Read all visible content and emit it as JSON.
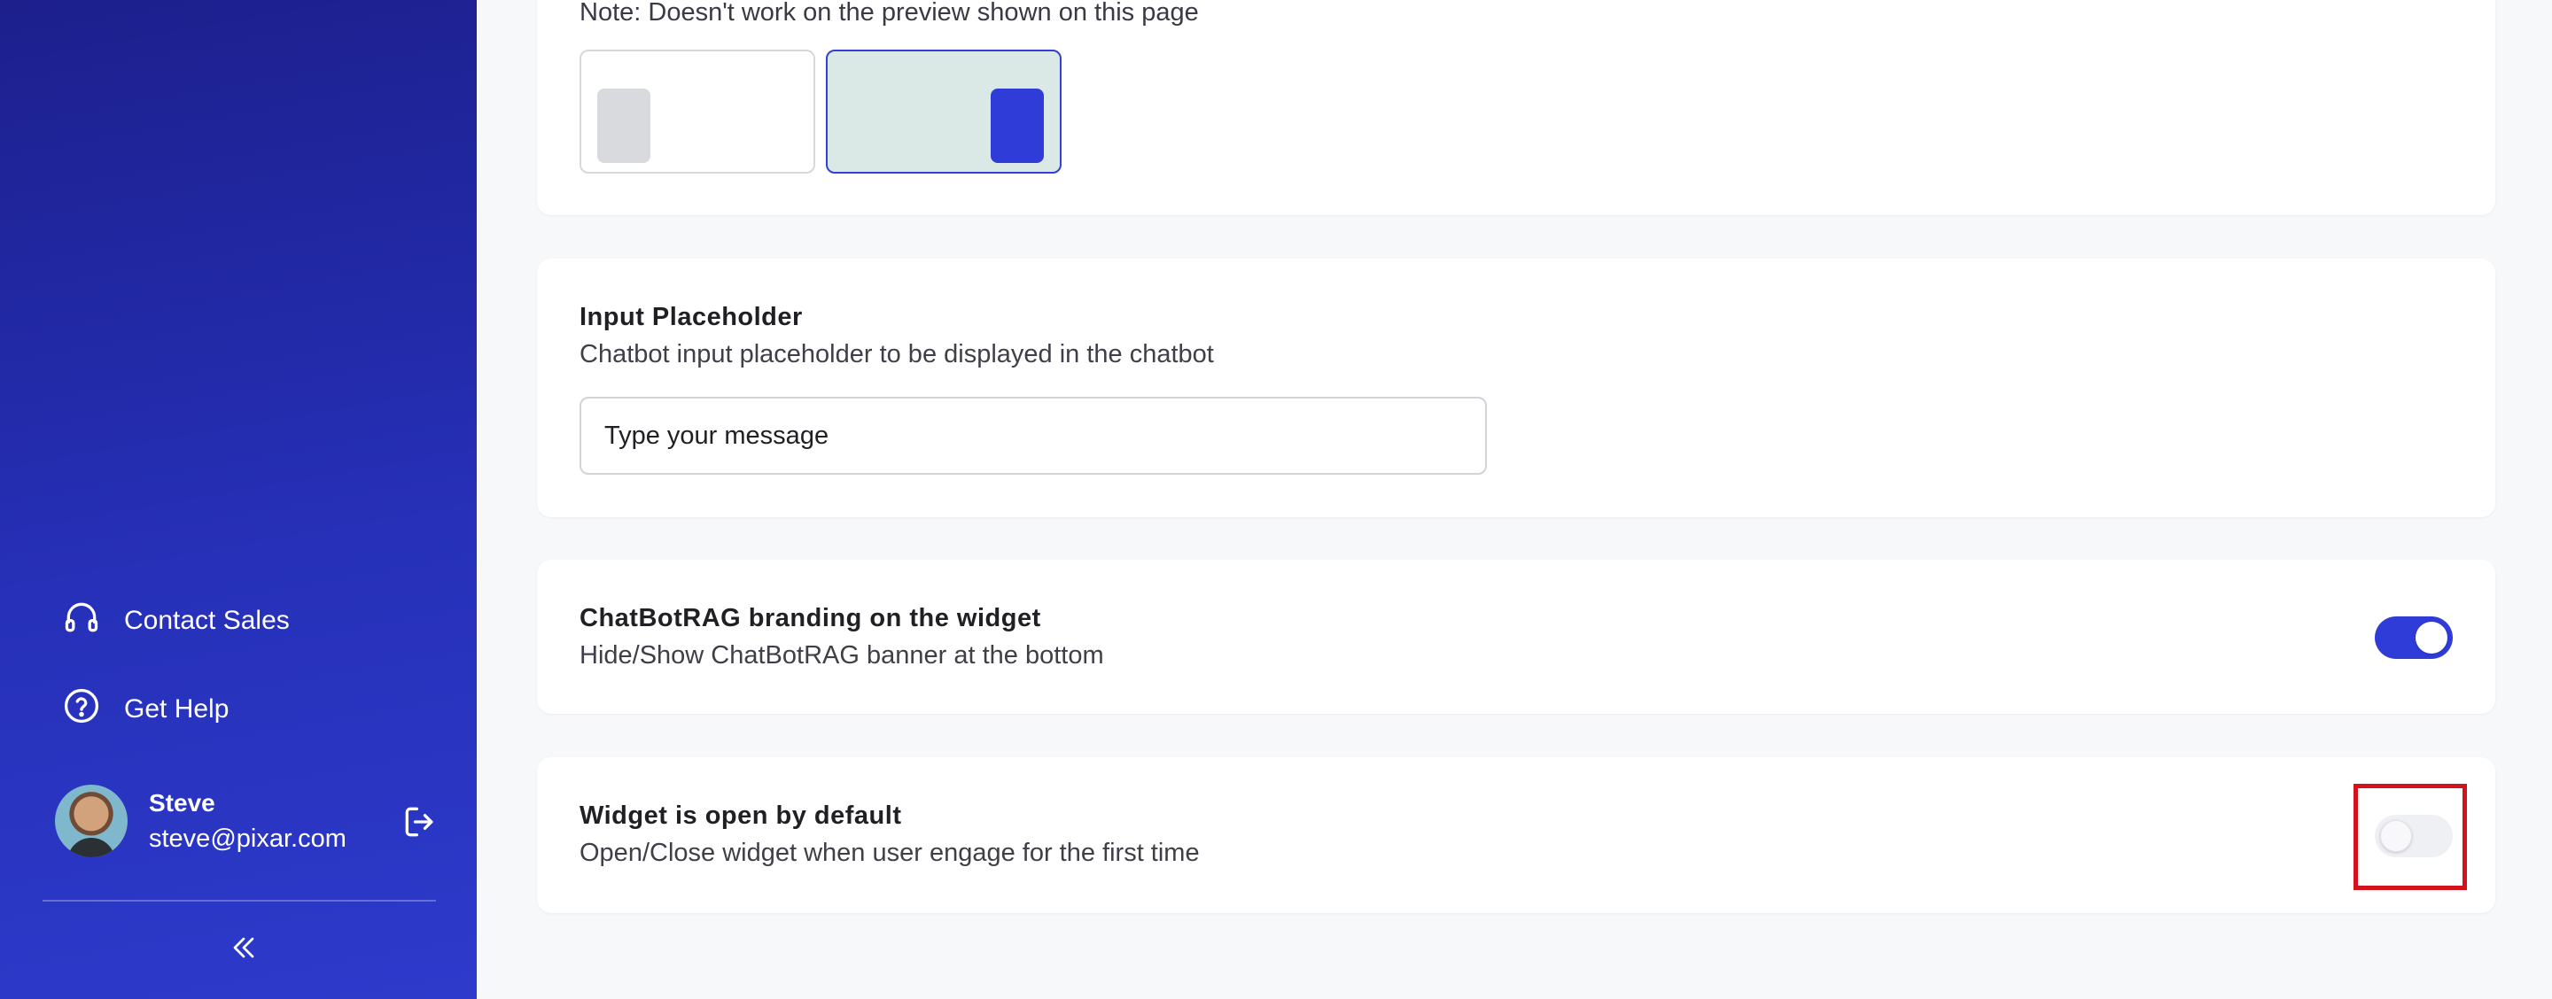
{
  "sidebar": {
    "nav": [
      {
        "label": "Contact Sales",
        "icon": "headset-icon"
      },
      {
        "label": "Get Help",
        "icon": "help-circle-icon"
      }
    ],
    "user": {
      "name": "Steve",
      "email": "steve@pixar.com"
    },
    "logout_icon": "logout-icon",
    "collapse_icon": "chevrons-left-icon"
  },
  "widget_position": {
    "note": "Note: Doesn't work on the preview shown on this page",
    "options": [
      "left",
      "right"
    ],
    "selected": "right"
  },
  "input_placeholder": {
    "title": "Input Placeholder",
    "description": "Chatbot input placeholder to be displayed in the chatbot",
    "value": "Type your message"
  },
  "branding": {
    "title": "ChatBotRAG branding on the widget",
    "description": "Hide/Show ChatBotRAG banner at the bottom",
    "enabled": true
  },
  "open_by_default": {
    "title": "Widget is open by default",
    "description": "Open/Close widget when user engage for the first time",
    "enabled": false
  },
  "colors": {
    "sidebar_top": "#1c1f8c",
    "sidebar_bottom": "#2d3acb",
    "accent": "#2f3cd8",
    "highlight": "#d4121b"
  }
}
